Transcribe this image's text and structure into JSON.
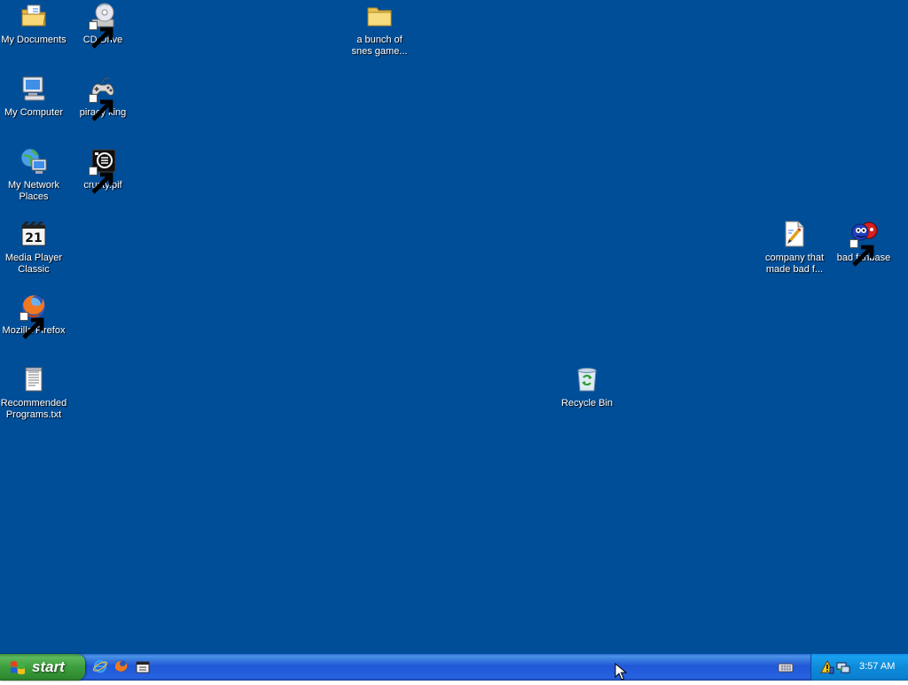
{
  "desktop": {
    "background": "#004e98",
    "icons": {
      "my_documents": "My Documents",
      "cd_drive": "CD Drive",
      "snes_folder": "a bunch of snes game...",
      "my_computer": "My Computer",
      "piracy_king": "piracy king",
      "my_network_places": "My Network Places",
      "crusty": "crusty.pif",
      "media_player_classic": "Media Player Classic",
      "company_file": "company that made bad f...",
      "bad_fanbase": "bad fanbase",
      "mozilla_firefox": "Mozilla Firefox",
      "recommended_programs": "Recommended Programs.txt",
      "recycle_bin": "Recycle Bin"
    }
  },
  "taskbar": {
    "start_label": "start",
    "clock": "3:57 AM",
    "quick_launch": [
      "internet-explorer-icon",
      "firefox-icon",
      "media-player-classic-icon"
    ],
    "tray_icons": [
      "safety-warning-icon",
      "network-icon"
    ],
    "colors": {
      "start": "#3c9e3c",
      "taskbar": "#2157d7",
      "tray": "#0d8ad8"
    }
  }
}
